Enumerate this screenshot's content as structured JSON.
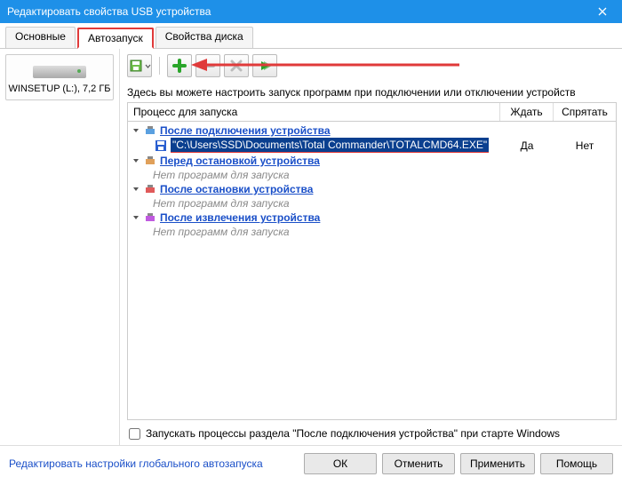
{
  "window": {
    "title": "Редактировать свойства USB устройства"
  },
  "tabs": {
    "t0": "Основные",
    "t1": "Автозапуск",
    "t2": "Свойства диска"
  },
  "drive": {
    "label": "WINSETUP (L:), 7,2 ГБ"
  },
  "toolbar": {
    "desc": "Здесь вы можете настроить запуск программ при подключении или отключении устройств"
  },
  "columns": {
    "process": "Процесс для запуска",
    "wait": "Ждать",
    "hide": "Спрятать"
  },
  "tree": {
    "s1": "После подключения устройства",
    "s1_item": "\"C:\\Users\\SSD\\Documents\\Total Commander\\TOTALCMD64.EXE\"",
    "s1_wait": "Да",
    "s1_hide": "Нет",
    "s2": "Перед остановкой устройства",
    "s3": "После остановки устройства",
    "s4": "После извлечения устройства",
    "noprog": "Нет программ для запуска"
  },
  "checkbox": {
    "label": "Запускать процессы раздела \"После подключения устройства\" при старте Windows"
  },
  "footer": {
    "link": "Редактировать настройки глобального автозапуска",
    "ok": "ОК",
    "cancel": "Отменить",
    "apply": "Применить",
    "help": "Помощь"
  }
}
